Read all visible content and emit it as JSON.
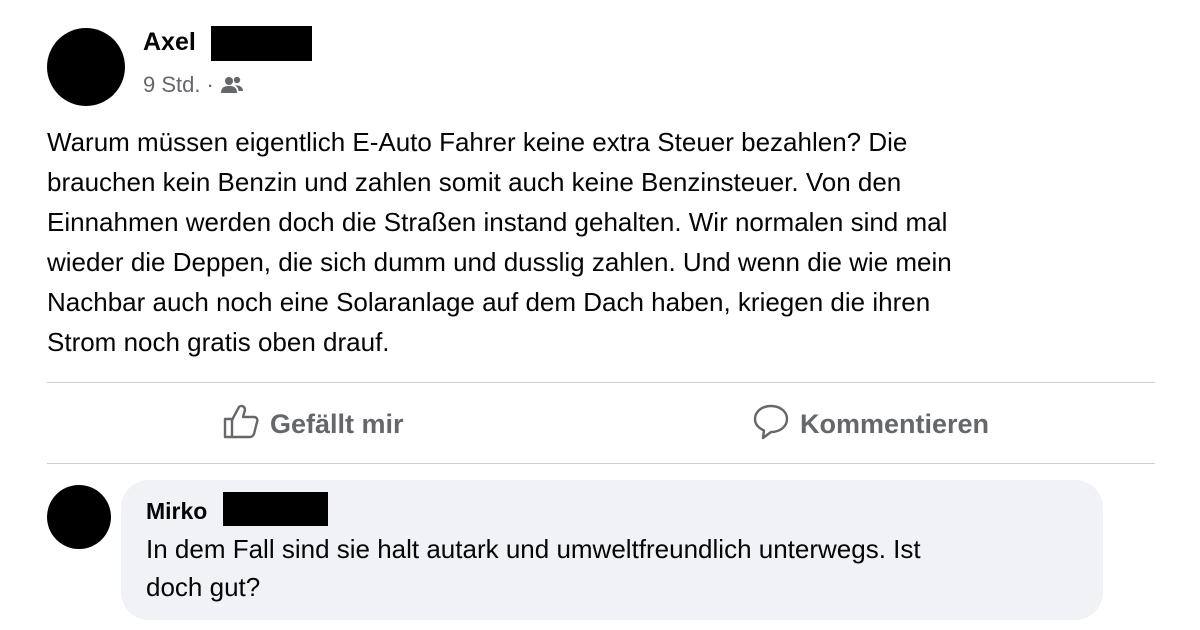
{
  "post": {
    "author_name": "Axel",
    "time": "9 Std.",
    "separator": "·",
    "audience_icon": "friends-icon",
    "text_lines": [
      "Warum müssen eigentlich E-Auto Fahrer keine extra Steuer bezahlen? Die",
      "brauchen kein Benzin und zahlen somit auch keine Benzinsteuer. Von den",
      "Einnahmen werden doch die Straßen instand gehalten. Wir normalen sind mal",
      "wieder die Deppen, die sich dumm und dusslig zahlen. Und wenn die wie mein",
      "Nachbar auch noch eine Solaranlage auf dem Dach haben, kriegen die ihren",
      "Strom noch gratis oben drauf."
    ]
  },
  "actions": {
    "like_label": "Gefällt mir",
    "like_icon": "thumbs-up-icon",
    "comment_label": "Kommentieren",
    "comment_icon": "comment-bubble-icon"
  },
  "comment": {
    "author_name": "Mirko",
    "text_lines": [
      "In dem Fall sind sie halt autark und umweltfreundlich unterwegs. Ist",
      "doch gut?"
    ]
  },
  "colors": {
    "text": "#050505",
    "secondary_text": "#65676b",
    "divider": "#ced0d4",
    "comment_bubble": "#f0f2f5",
    "redaction": "#000000"
  }
}
